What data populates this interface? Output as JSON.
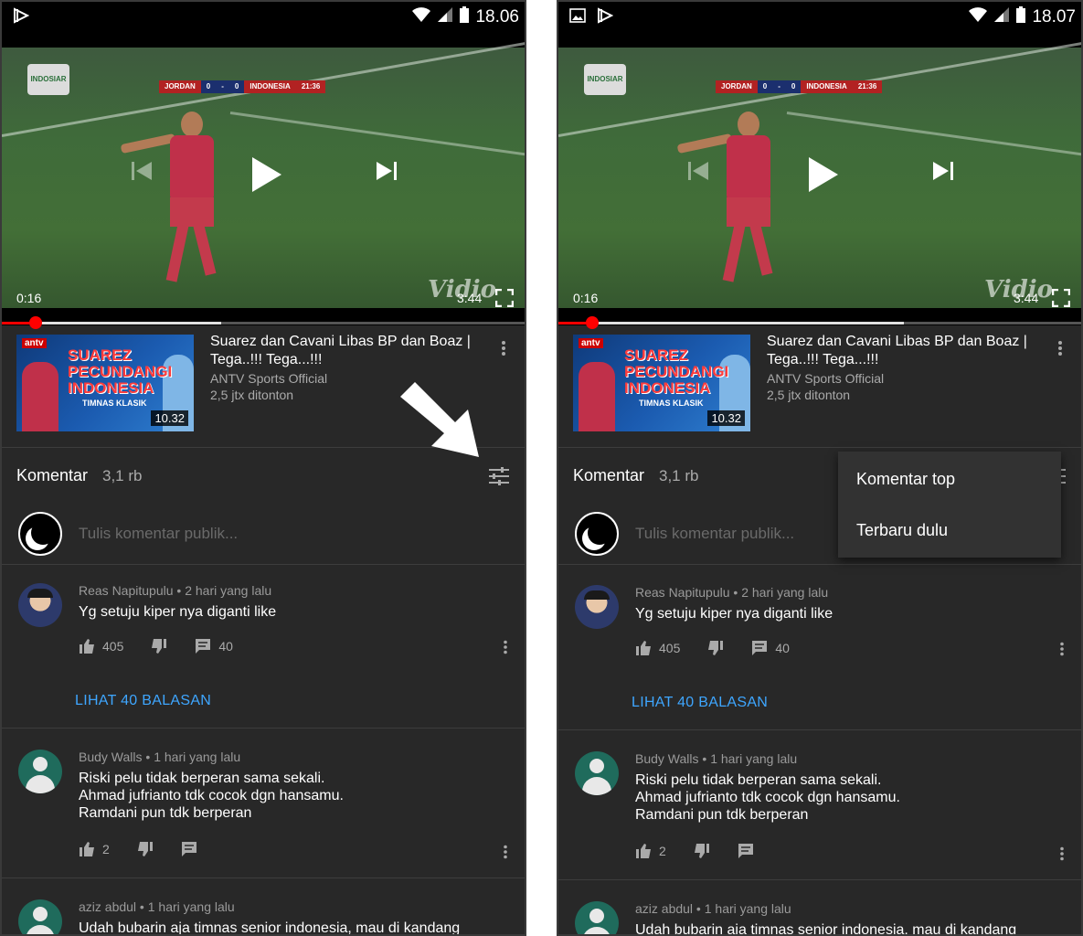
{
  "status": {
    "time_left": "18.06",
    "time_right": "18.07"
  },
  "video": {
    "current_time": "0:16",
    "duration": "3:44",
    "watermark": "Vidio",
    "channel_logo": "INDOSIAR",
    "scoreboard": {
      "team_a": "JORDAN",
      "score_a": "0",
      "sep": "-",
      "score_b": "0",
      "team_b": "INDONESIA",
      "clock": "21:36"
    },
    "progress_played_fraction": 0.065,
    "progress_buffered_fraction": 0.42
  },
  "info": {
    "title": "Suarez dan Cavani Libas BP dan Boaz | Tega..!!! Tega...!!!",
    "channel": "ANTV Sports Official",
    "views": "2,5 jtx ditonton",
    "thumb_duration": "10.32",
    "thumb_brand": "antv",
    "thumb_title": "SUAREZ PECUNDANGI INDONESIA",
    "thumb_badge": "TIMNAS KLASIK"
  },
  "comments_header": {
    "label": "Komentar",
    "count": "3,1 rb",
    "placeholder": "Tulis komentar publik..."
  },
  "sort_menu": {
    "option_top": "Komentar top",
    "option_newest": "Terbaru dulu"
  },
  "comments": [
    {
      "author": "Reas Napitupulu",
      "time": "2 hari yang lalu",
      "text": "Yg setuju kiper nya diganti like",
      "likes": "405",
      "replies_count": "40",
      "view_replies": "LIHAT 40 BALASAN"
    },
    {
      "author": "Budy Walls",
      "time": "1 hari yang lalu",
      "text_lines": [
        "Riski pelu tidak berperan sama sekali.",
        "Ahmad jufrianto tdk cocok dgn hansamu.",
        "Ramdani pun tdk berperan"
      ],
      "likes": "2"
    },
    {
      "author": "aziz abdul",
      "time": "1 hari yang lalu",
      "text": "Udah bubarin aja timnas senior indonesia, mau di kandang"
    }
  ],
  "colors": {
    "background": "#282828",
    "accent_red": "#ff0000",
    "link_blue": "#3ea6ff",
    "menu_bg": "#323232"
  }
}
